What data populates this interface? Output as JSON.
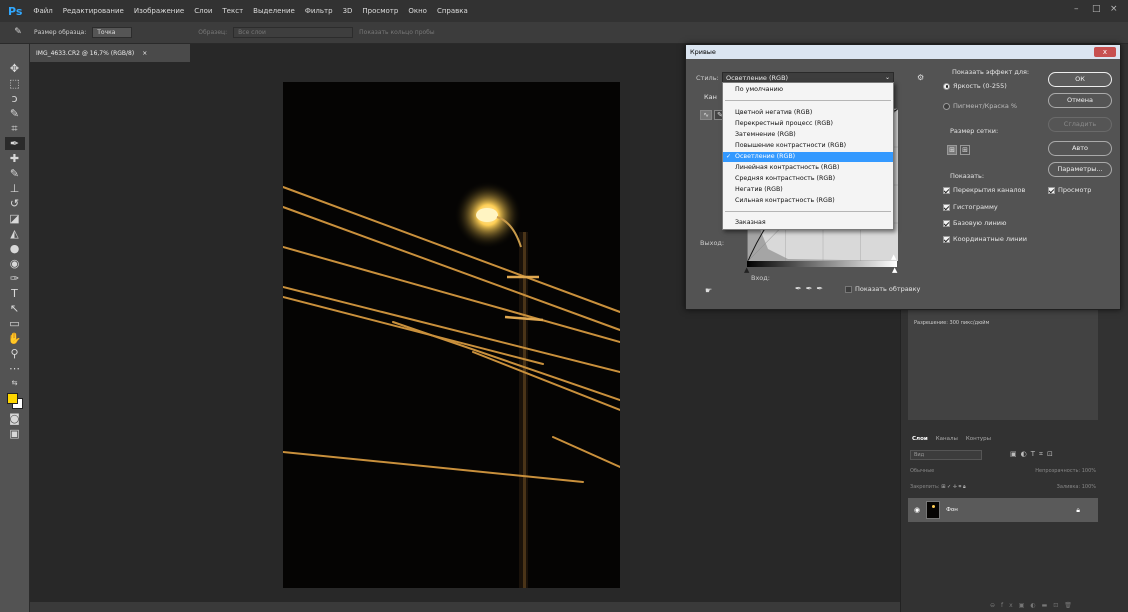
{
  "app": {
    "logo": "Ps",
    "menu": [
      "Файл",
      "Редактирование",
      "Изображение",
      "Слои",
      "Текст",
      "Выделение",
      "Фильтр",
      "3D",
      "Просмотр",
      "Окно",
      "Справка"
    ],
    "window_controls": [
      "–",
      "□",
      "×"
    ]
  },
  "options_bar": {
    "sample_size_label": "Размер образца:",
    "sample_size_value": "Точка",
    "sample_label": "Образец:",
    "sample_value": "Все слои",
    "show_ring_label": "Показать кольцо пробы"
  },
  "document": {
    "tab_title": "IMG_4633.CR2 @ 16,7% (RGB/8)",
    "tab_close": "×"
  },
  "curves_dialog": {
    "title": "Кривые",
    "close": "x",
    "style_label": "Стиль:",
    "style_value": "Осветление (RGB)",
    "channel_label_fragment": "Кан",
    "output_label": "Выход:",
    "input_label": "Вход:",
    "show_clipping_label": "Показать обтравку",
    "show_effect_label": "Показать эффект для:",
    "radio_options": [
      {
        "label": "Яркость (0-255)",
        "checked": true
      },
      {
        "label": "Пигмент/Краска %",
        "checked": false
      }
    ],
    "grid_size_label": "Размер сетки:",
    "show_label": "Показать:",
    "show_options": [
      {
        "label": "Перекрытия каналов",
        "checked": true
      },
      {
        "label": "Гистограмму",
        "checked": true
      },
      {
        "label": "Базовую линию",
        "checked": true
      },
      {
        "label": "Координатные линии",
        "checked": true
      }
    ],
    "buttons": {
      "ok": "ОК",
      "cancel": "Отмена",
      "smooth": "Сгладить",
      "auto": "Авто",
      "options": "Параметры..."
    },
    "preview_label": "Просмотр",
    "preview_checked": true,
    "dropdown": {
      "items_group1": [
        "По умолчанию"
      ],
      "items_group2": [
        "Цветной негатив (RGB)",
        "Перекрестный процесс (RGB)",
        "Затемнение (RGB)",
        "Повышение контрастности (RGB)",
        "Осветление (RGB)",
        "Линейная контрастность (RGB)",
        "Средняя контрастность (RGB)",
        "Негатив (RGB)",
        "Сильная контрастность (RGB)"
      ],
      "selected": "Осветление (RGB)",
      "items_group3": [
        "Заказная"
      ]
    }
  },
  "right_panels": {
    "info_text": "Разрешение: 300 пикс/дюйм",
    "layers_tabs": [
      "Слои",
      "Каналы",
      "Контуры"
    ],
    "layers_search_placeholder": "Вид",
    "blend_mode": "Обычные",
    "opacity_label": "Непрозрачность:",
    "opacity_value": "100%",
    "lock_label": "Закрепить:",
    "fill_label": "Заливка:",
    "fill_value": "100%",
    "layer_name": "Фон"
  },
  "colors": {
    "accent": "#31a8ff",
    "foreground_swatch": "#ffd700",
    "background_swatch": "#ffffff",
    "selection": "#3399ff"
  }
}
